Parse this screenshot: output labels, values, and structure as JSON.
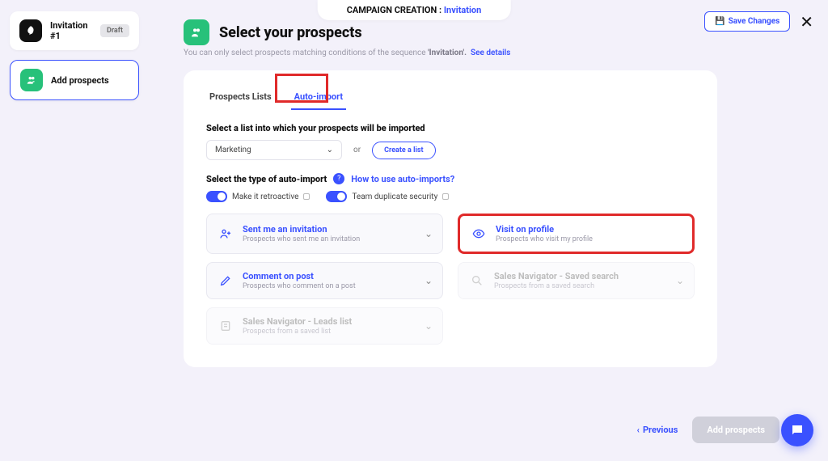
{
  "header": {
    "breadcrumb_label": "CAMPAIGN CREATION :",
    "breadcrumb_current": "Invitation",
    "save_label": "Save Changes"
  },
  "sidebar": {
    "card1_title": "Invitation #1",
    "card1_badge": "Draft",
    "card2_title": "Add prospects"
  },
  "section": {
    "title": "Select your prospects",
    "subtext_pre": "You can only select prospects matching conditions of the sequence ",
    "subtext_bold": "'Invitation'.",
    "subtext_link": "See details"
  },
  "tabs": {
    "tab1": "Prospects Lists",
    "tab2": "Auto-import"
  },
  "form": {
    "list_label": "Select a list into which your prospects will be imported",
    "select_value": "Marketing",
    "or": "or",
    "create_label": "Create a list",
    "type_label": "Select the type of auto-import",
    "help_link": "How to use auto-imports?",
    "toggle1": "Make it retroactive",
    "toggle2": "Team duplicate security"
  },
  "options": [
    {
      "title": "Sent me an invitation",
      "desc": "Prospects who sent me an invitation"
    },
    {
      "title": "Visit on profile",
      "desc": "Prospects who visit my profile"
    },
    {
      "title": "Comment on post",
      "desc": "Prospects who comment on a post"
    },
    {
      "title": "Sales Navigator - Saved search",
      "desc": "Prospects from a saved search"
    },
    {
      "title": "Sales Navigator - Leads list",
      "desc": "Prospects from a saved list"
    }
  ],
  "footer": {
    "prev": "Previous",
    "add": "Add prospects"
  }
}
